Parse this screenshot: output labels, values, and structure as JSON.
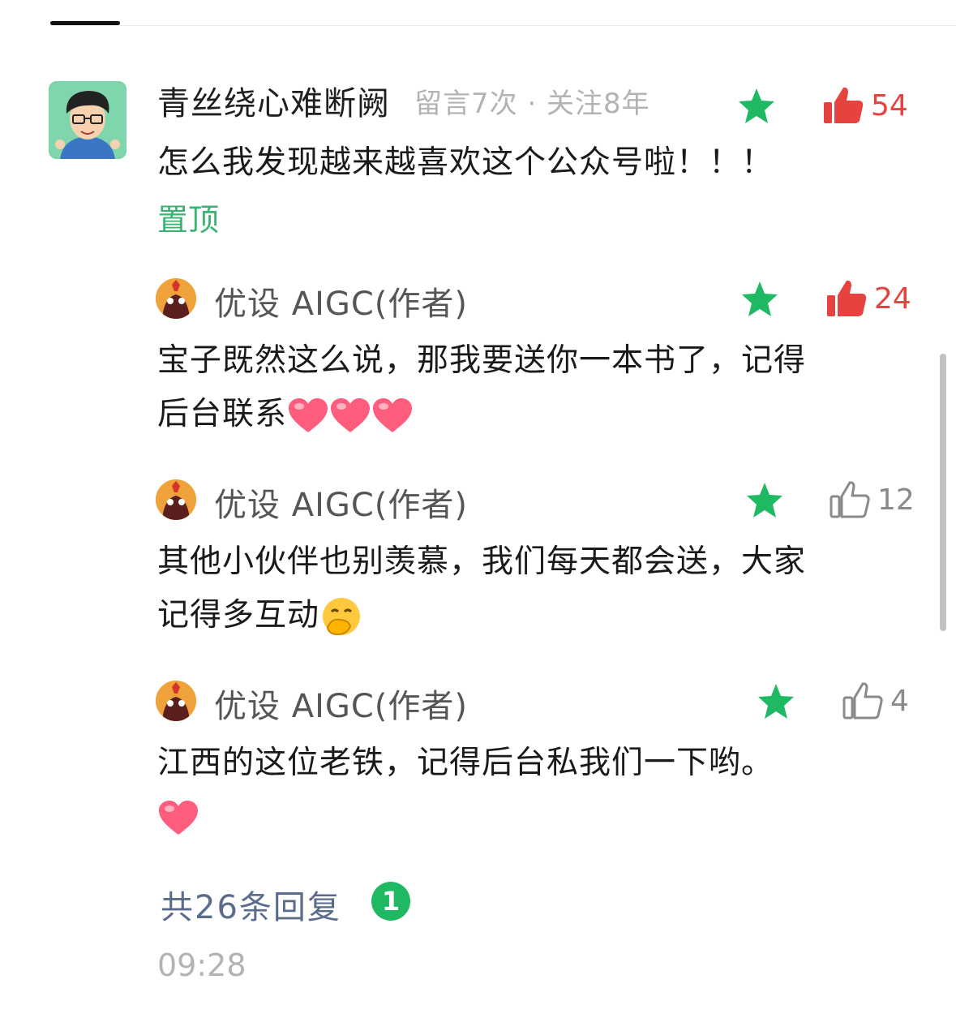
{
  "comment": {
    "nickname": "青丝绕心难断阙",
    "meta": "留言7次 · 关注8年",
    "text": "怎么我发现越来越喜欢这个公众号啦！！！",
    "pin_label": "置顶",
    "likes": "54",
    "liked": true
  },
  "replies": [
    {
      "author": "优设 AIGC(作者)",
      "text_line1": "宝子既然这么说，那我要送你一本书了，记得",
      "text_line2": "后台联系",
      "likes": "24",
      "liked": true
    },
    {
      "author": "优设 AIGC(作者)",
      "text_line1": "其他小伙伴也别羡慕，我们每天都会送，大家",
      "text_line2": "记得多互动",
      "likes": "12",
      "liked": false
    },
    {
      "author": "优设 AIGC(作者)",
      "text_line1": "江西的这位老铁，记得后台私我们一下哟。",
      "likes": "4",
      "liked": false
    }
  ],
  "footer": {
    "total_replies": "共26条回复",
    "badge_count": "1",
    "timestamp": "09:28"
  },
  "colors": {
    "star": "#1fb863",
    "like_active": "#e64340",
    "link_green": "#3bb273",
    "link_blue": "#5a6b8c"
  },
  "icons": [
    "star-icon",
    "thumbs-up-filled-icon",
    "thumbs-up-outline-icon",
    "heart-emoji",
    "hand-over-mouth-emoji"
  ]
}
